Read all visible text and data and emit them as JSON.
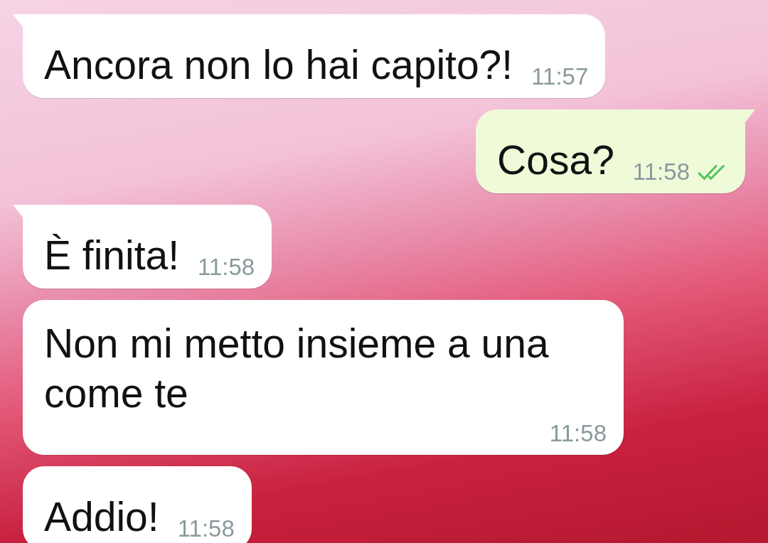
{
  "messages": [
    {
      "kind": "incoming",
      "tail": true,
      "text": "Ancora non lo hai capito?!",
      "time": "11:57"
    },
    {
      "kind": "outgoing",
      "tail": true,
      "text": "Cosa?",
      "time": "11:58",
      "read": true
    },
    {
      "kind": "incoming",
      "tail": true,
      "text": "È finita!",
      "time": "11:58"
    },
    {
      "kind": "incoming",
      "tail": false,
      "text": "Non mi metto insieme a una come te",
      "time": "11:58"
    },
    {
      "kind": "incoming",
      "tail": false,
      "text": "Addio!",
      "time": "11:58"
    }
  ]
}
